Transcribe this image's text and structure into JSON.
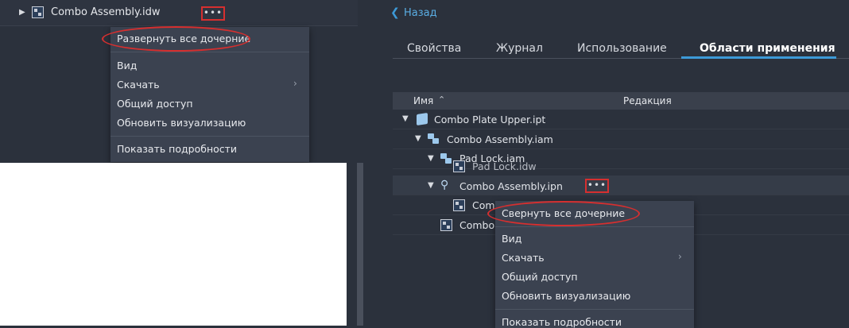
{
  "left": {
    "file_name": "Combo Assembly.idw",
    "more_label": "•••",
    "context_menu": {
      "expand_all": "Развернуть все дочерние",
      "view": "Вид",
      "download": "Скачать",
      "share": "Общий доступ",
      "update_visualization": "Обновить визуализацию",
      "show_details": "Показать подробности"
    }
  },
  "right": {
    "back_label": "Назад",
    "tabs": [
      "Свойства",
      "Журнал",
      "Использование",
      "Области применения"
    ],
    "active_tab": "Области применения",
    "columns": {
      "name": "Имя",
      "revision": "Редакция"
    },
    "rows": [
      "Combo Plate Upper.ipt",
      "Combo Assembly.iam",
      "Pad Lock.iam",
      "Pad Lock.idw",
      "Combo Assembly.ipn",
      "Comb",
      "Combo A"
    ],
    "more_label": "•••",
    "context_menu": {
      "collapse_all": "Свернуть все дочерние",
      "view": "Вид",
      "download": "Скачать",
      "share": "Общий доступ",
      "update_visualization": "Обновить визуализацию",
      "show_details": "Показать подробности"
    }
  },
  "colors": {
    "accent_blue": "#3d9ad8",
    "highlight_red": "#d62f2f",
    "panel_bg": "#2b313c",
    "menu_bg": "#3b4250"
  }
}
